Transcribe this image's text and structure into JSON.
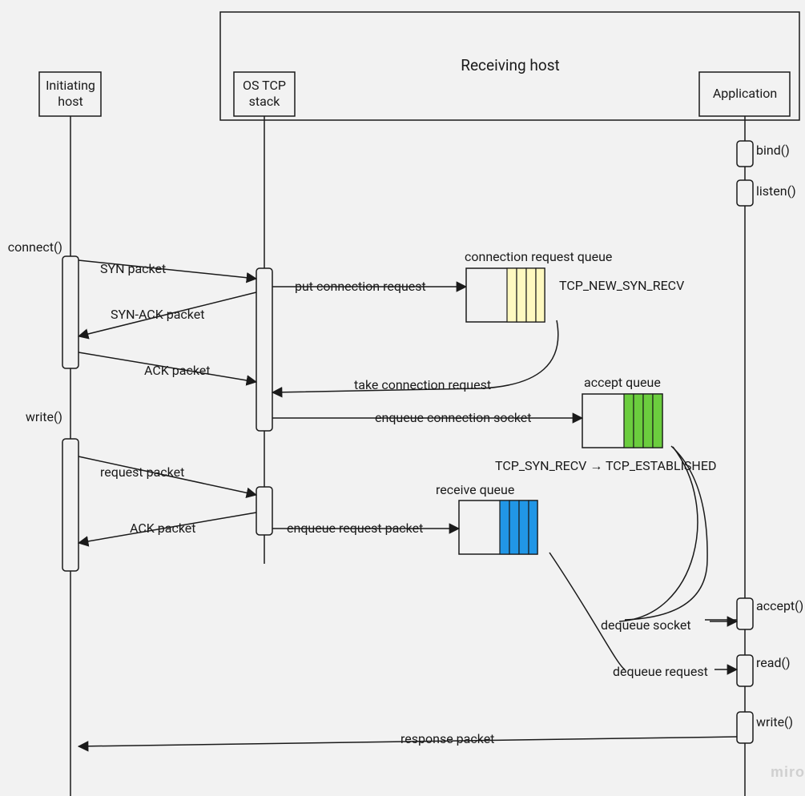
{
  "receiving_host_title": "Receiving host",
  "lifelines": {
    "initiating": "Initiating\nhost",
    "os_tcp": "OS TCP\nstack",
    "application": "Application"
  },
  "calls": {
    "bind": "bind()",
    "listen": "listen()",
    "connect": "connect()",
    "write_client": "write()",
    "accept": "accept()",
    "read": "read()",
    "write_server": "write()"
  },
  "messages": {
    "syn": "SYN packet",
    "synack": "SYN-ACK packet",
    "ack": "ACK packet",
    "put_conn": "put connection request",
    "take_conn": "take connection request",
    "enqueue_sock": "enqueue connection socket",
    "req_packet": "request packet",
    "ack_packet": "ACK packet",
    "enqueue_req": "enqueue request packet",
    "dequeue_sock": "dequeue socket",
    "dequeue_req": "dequeue request",
    "response": "response packet"
  },
  "queues": {
    "conn_req": "connection request queue",
    "accept": "accept queue",
    "receive": "receive queue"
  },
  "states": {
    "new_syn": "TCP_NEW_SYN_RECV",
    "transition": "TCP_SYN_RECV → TCP_ESTABLISHED"
  },
  "watermark": "miro"
}
